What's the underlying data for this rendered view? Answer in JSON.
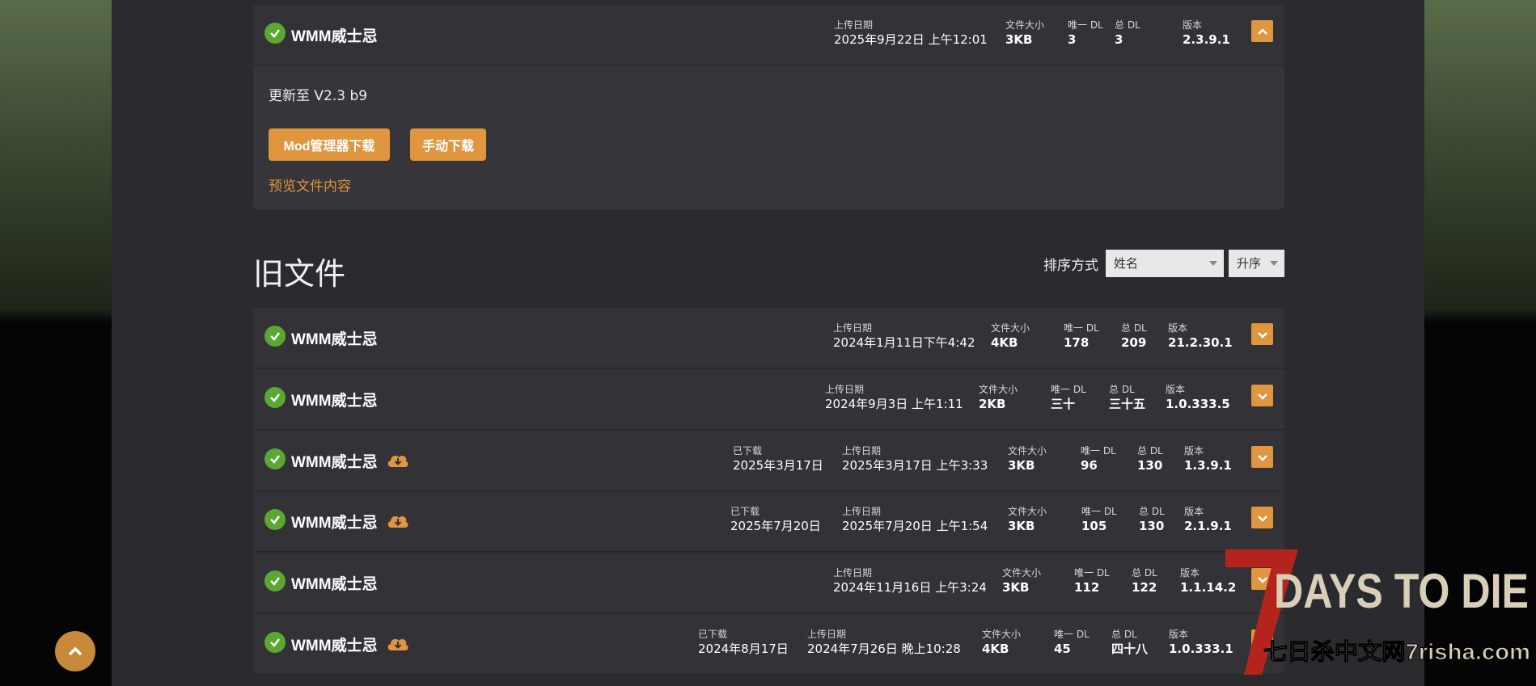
{
  "current_file": {
    "name": "WMM威士忌",
    "upload_label": "上传日期",
    "upload_date": "2025年9月22日 上午12:01",
    "size_label": "文件大小",
    "size": "3KB",
    "unique_label": "唯一 DL",
    "unique": "3",
    "total_label": "总 DL",
    "total": "3",
    "version_label": "版本",
    "version": "2.3.9.1",
    "description": "更新至 V2.3 b9",
    "mod_manager_btn": "Mod管理器下载",
    "manual_btn": "手动下载",
    "preview_link": "预览文件内容"
  },
  "old_files": {
    "title": "旧文件",
    "sort_label": "排序方式",
    "sort_field": "姓名",
    "sort_order": "升序",
    "rows": [
      {
        "name": "WMM威士忌",
        "downloaded": false,
        "downloaded_label": "",
        "downloaded_date": "",
        "upload_label": "上传日期",
        "upload_date": "2024年1月11日下午4:42",
        "size_label": "文件大小",
        "size": "4KB",
        "unique_label": "唯一 DL",
        "unique": "178",
        "total_label": "总 DL",
        "total": "209",
        "version_label": "版本",
        "version": "21.2.30.1"
      },
      {
        "name": "WMM威士忌",
        "downloaded": false,
        "downloaded_label": "",
        "downloaded_date": "",
        "upload_label": "上传日期",
        "upload_date": "2024年9月3日 上午1:11",
        "size_label": "文件大小",
        "size": "2KB",
        "unique_label": "唯一 DL",
        "unique": "三十",
        "total_label": "总 DL",
        "total": "三十五",
        "version_label": "版本",
        "version": "1.0.333.5"
      },
      {
        "name": "WMM威士忌",
        "downloaded": true,
        "downloaded_label": "已下载",
        "downloaded_date": "2025年3月17日",
        "upload_label": "上传日期",
        "upload_date": "2025年3月17日 上午3:33",
        "size_label": "文件大小",
        "size": "3KB",
        "unique_label": "唯一 DL",
        "unique": "96",
        "total_label": "总 DL",
        "total": "130",
        "version_label": "版本",
        "version": "1.3.9.1"
      },
      {
        "name": "WMM威士忌",
        "downloaded": true,
        "downloaded_label": "已下载",
        "downloaded_date": "2025年7月20日",
        "upload_label": "上传日期",
        "upload_date": "2025年7月20日 上午1:54",
        "size_label": "文件大小",
        "size": "3KB",
        "unique_label": "唯一 DL",
        "unique": "105",
        "total_label": "总 DL",
        "total": "130",
        "version_label": "版本",
        "version": "2.1.9.1"
      },
      {
        "name": "WMM威士忌",
        "downloaded": false,
        "downloaded_label": "",
        "downloaded_date": "",
        "upload_label": "上传日期",
        "upload_date": "2024年11月16日 上午3:24",
        "size_label": "文件大小",
        "size": "3KB",
        "unique_label": "唯一 DL",
        "unique": "112",
        "total_label": "总 DL",
        "total": "122",
        "version_label": "版本",
        "version": "1.1.14.2"
      },
      {
        "name": "WMM威士忌",
        "downloaded": true,
        "downloaded_label": "已下载",
        "downloaded_date": "2024年8月17日",
        "upload_label": "上传日期",
        "upload_date": "2024年7月26日 晚上10:28",
        "size_label": "文件大小",
        "size": "4KB",
        "unique_label": "唯一 DL",
        "unique": "45",
        "total_label": "总 DL",
        "total": "四十八",
        "version_label": "版本",
        "version": "1.0.333.1"
      }
    ]
  },
  "watermark": {
    "logo_text": "DAYS TO DIE",
    "logo_number": "7",
    "site_text": "七日杀中文网7risha.com"
  },
  "colors": {
    "accent": "#e0953f",
    "check": "#5aa832",
    "background": "#2b2a2f",
    "row": "#323237"
  }
}
